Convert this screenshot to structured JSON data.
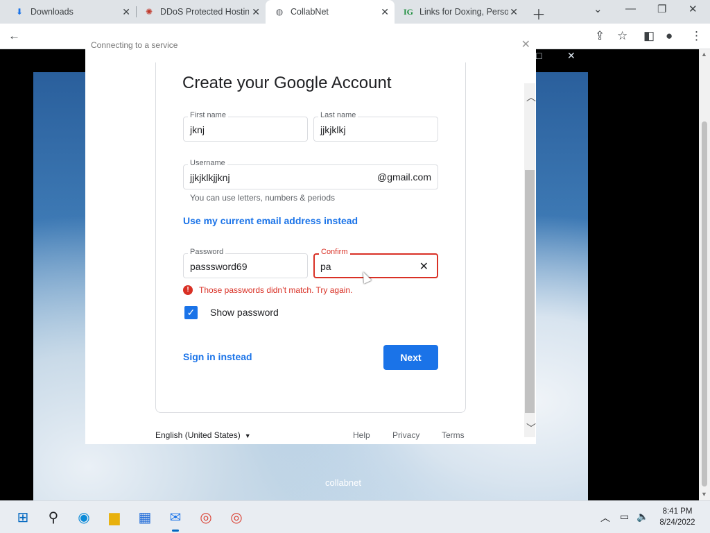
{
  "browser": {
    "tabs": [
      {
        "title": "Downloads",
        "icon": "download-icon"
      },
      {
        "title": "DDoS Protected Hostin",
        "icon": "site-icon"
      },
      {
        "title": "CollabNet",
        "icon": "globe-icon"
      },
      {
        "title": "Links for Doxing, Perso",
        "icon": "ig-icon",
        "icon_text": "IG"
      }
    ],
    "active_tab": 2
  },
  "dialog": {
    "title": "Connecting to a service"
  },
  "form": {
    "heading": "Create your Google Account",
    "first_name": {
      "label": "First name",
      "value": "jknj"
    },
    "last_name": {
      "label": "Last name",
      "value": "jjkjklkj"
    },
    "username": {
      "label": "Username",
      "value": "jjkjklkjjknj",
      "suffix": "@gmail.com"
    },
    "username_hint": "You can use letters, numbers & periods",
    "use_current_email": "Use my current email address instead",
    "password": {
      "label": "Password",
      "value": "passsword69"
    },
    "confirm": {
      "label": "Confirm",
      "value": "pa"
    },
    "error": "Those passwords didn’t match. Try again.",
    "show_password": "Show password",
    "show_password_checked": true,
    "sign_in_instead": "Sign in instead",
    "next": "Next"
  },
  "footer": {
    "language": "English (United States)",
    "help": "Help",
    "privacy": "Privacy",
    "terms": "Terms"
  },
  "page_caption": "collabnet",
  "taskbar": {
    "time": "8:41 PM",
    "date": "8/24/2022"
  },
  "colors": {
    "accent": "#1a73e8",
    "error": "#d93025"
  }
}
